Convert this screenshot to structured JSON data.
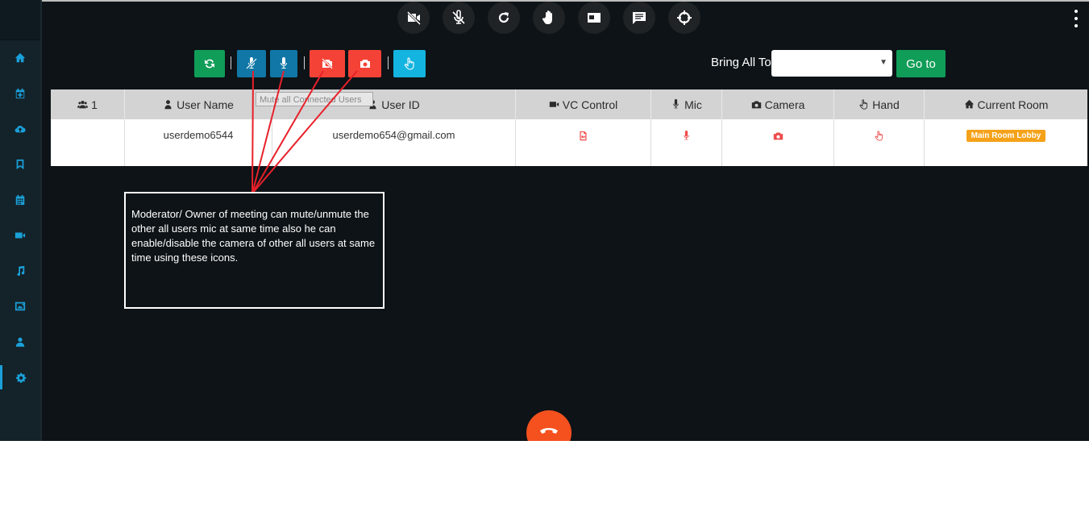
{
  "colors": {
    "background": "#0d1317",
    "sidebar": "#142229",
    "sidebar_icon": "#1aa0d8",
    "green": "#0f9d58",
    "blue": "#1077a6",
    "red": "#f44336",
    "cyan": "#14b4e0",
    "badge": "#f5a21a",
    "end_call": "#f4511e"
  },
  "sidebar": {
    "items": [
      "home-icon",
      "calendar-plus-icon",
      "cloud-upload-icon",
      "bookmark-icon",
      "calendar-icon",
      "video-icon",
      "music-icon",
      "image-icon",
      "user-icon",
      "cogs-icon"
    ],
    "active_item": "cogs-icon"
  },
  "top_toolbar": {
    "buttons": [
      "video-off-icon",
      "mic-off-icon",
      "refresh-icon",
      "raise-hand-icon",
      "screen-share-icon",
      "chat-icon",
      "crosshair-icon"
    ],
    "menu": "kebab-icon"
  },
  "controls": {
    "buttons": [
      "refresh-icon",
      "mic-mute-icon",
      "mic-icon",
      "camera-off-icon",
      "camera-icon",
      "hand-pointer-icon"
    ],
    "tooltip": "Mute all Connected Users",
    "bring_all_label": "Bring All To",
    "room_select_value": "",
    "goto_label": "Go to"
  },
  "table": {
    "headers": {
      "count": "1",
      "user_name": "User Name",
      "user_id": "User ID",
      "vc_control": "VC Control",
      "mic": "Mic",
      "camera": "Camera",
      "hand": "Hand",
      "current_room": "Current Room"
    },
    "rows": [
      {
        "count": "",
        "user_name": "userdemo6544",
        "user_id": "userdemo654@gmail.com",
        "vc_control": "video-file-icon",
        "mic": "microphone-icon",
        "camera": "camera-icon",
        "hand": "hand-pointer-icon",
        "current_room": "Main Room Lobby"
      }
    ]
  },
  "annotation": {
    "text": "Moderator/ Owner of meeting can mute/unmute the other all users mic at same time also he can enable/disable the camera of other all users at same time using these icons."
  },
  "end_call": "phone-hangup-icon"
}
